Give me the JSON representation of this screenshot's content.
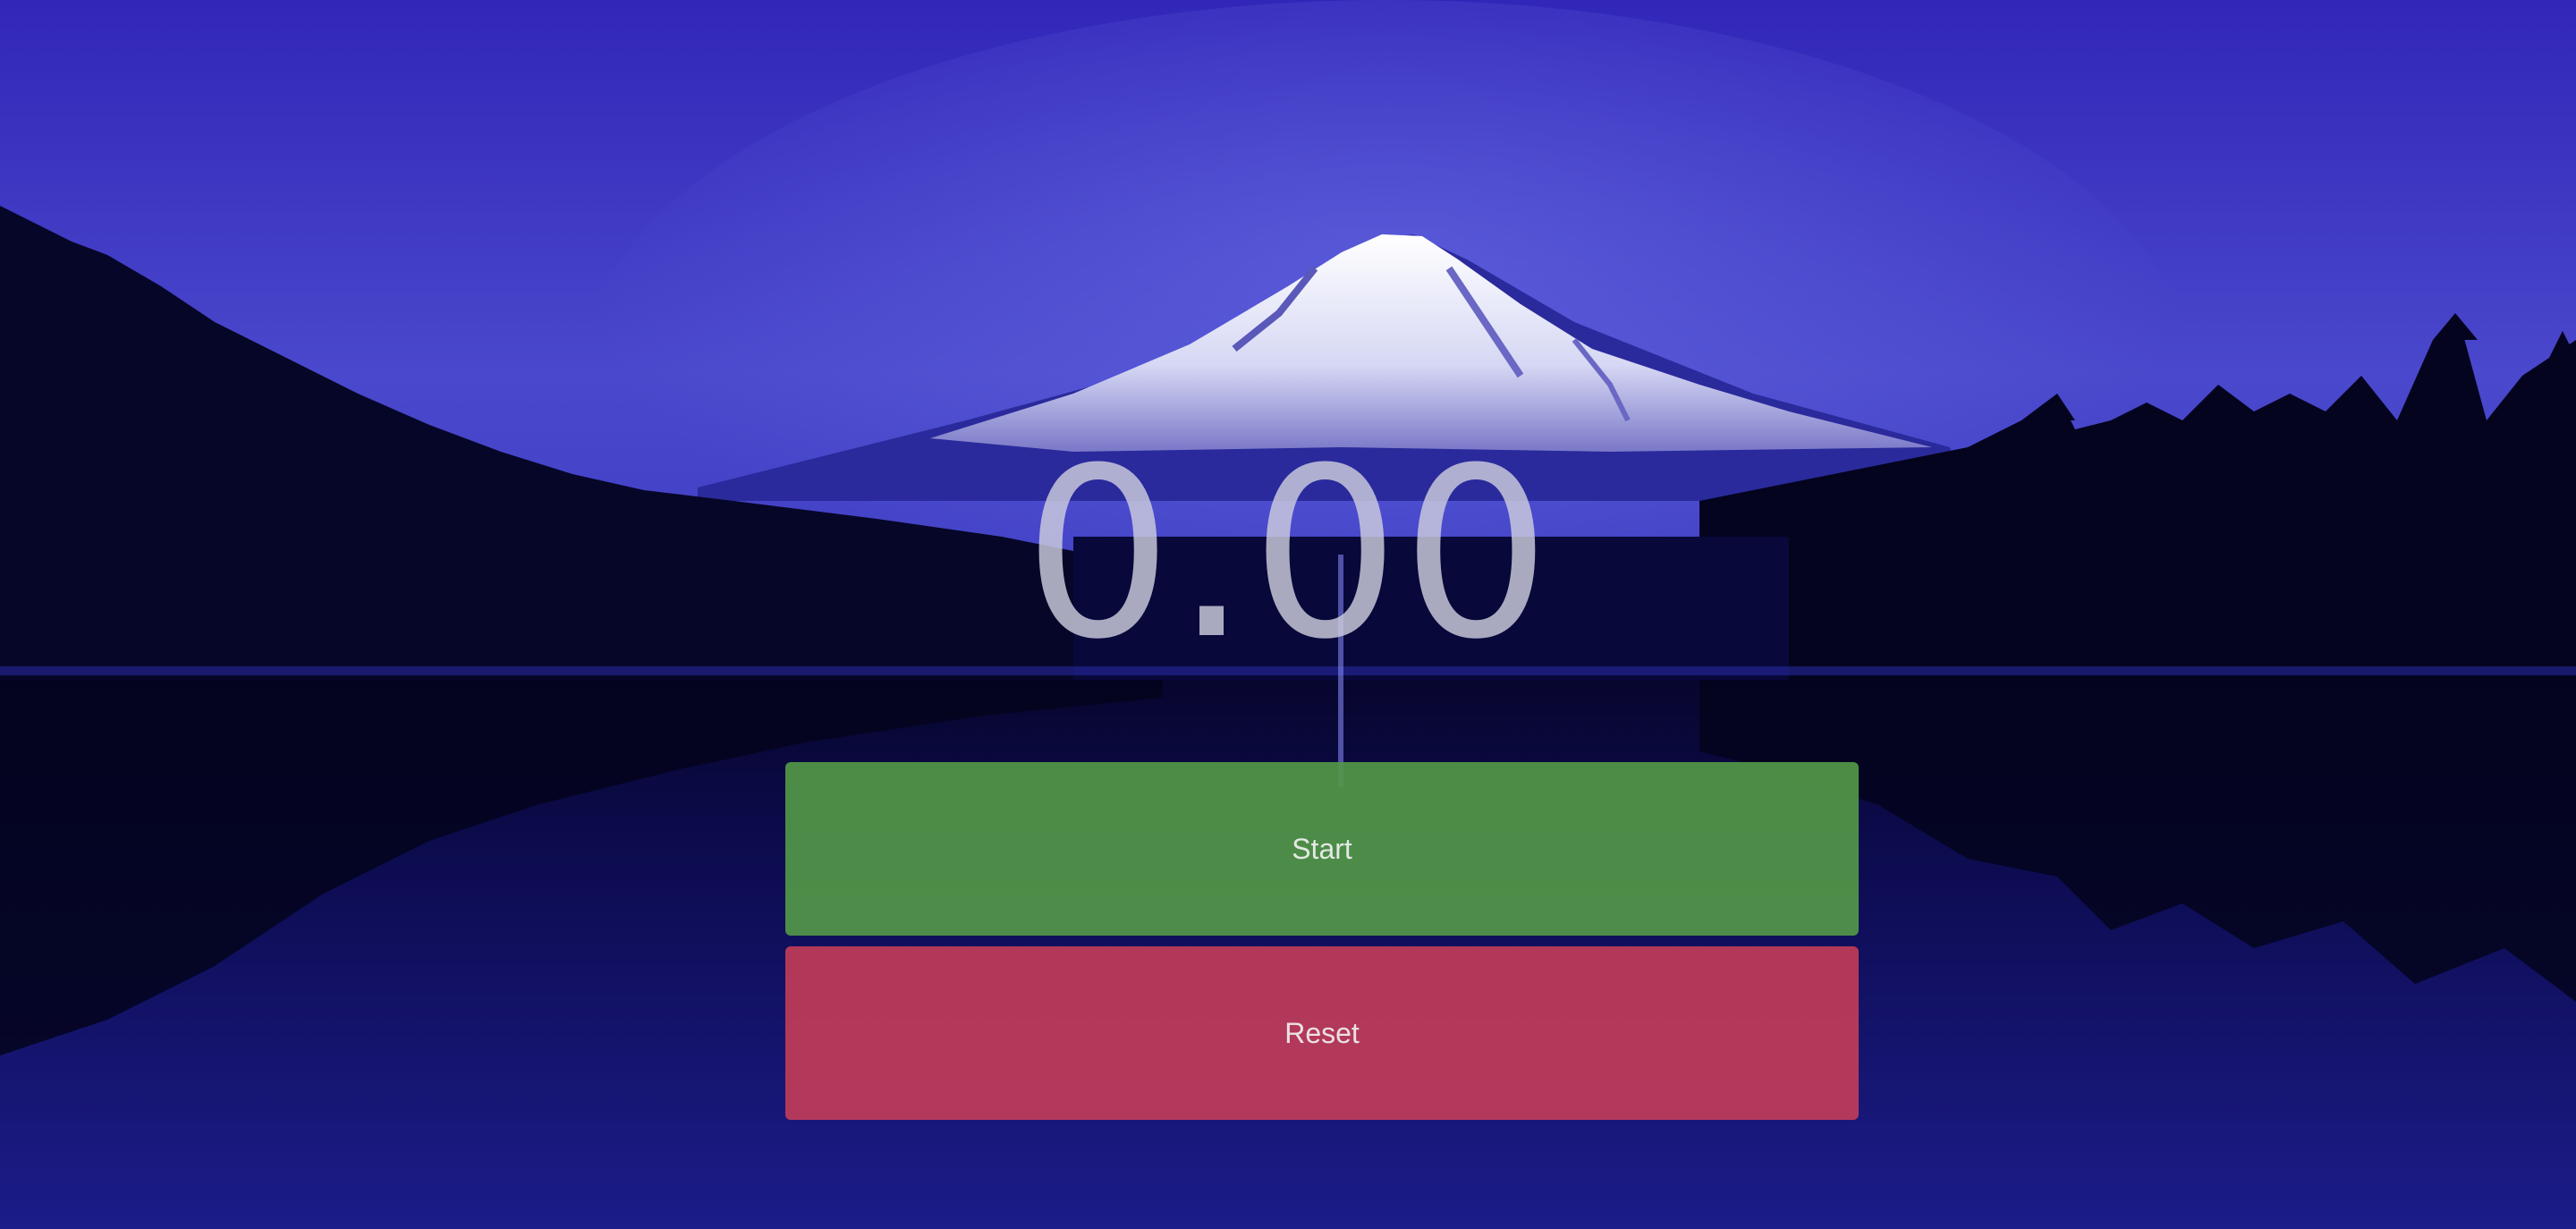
{
  "stopwatch": {
    "time_display": "0.00",
    "start_label": "Start",
    "reset_label": "Reset"
  },
  "background": {
    "subject": "snow-capped mountain over forested lake at night",
    "sky_color": "#3a33c4",
    "water_color": "#121072"
  },
  "colors": {
    "start_button": "#4f9446",
    "reset_button": "#c53f52",
    "timer_text": "#c8c8dc"
  }
}
